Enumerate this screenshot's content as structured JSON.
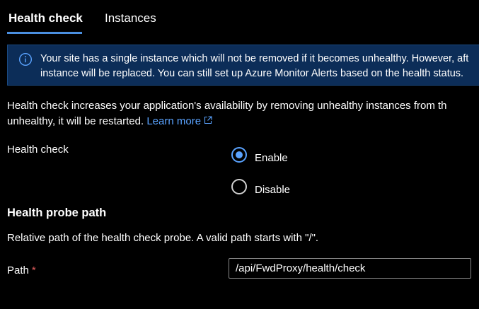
{
  "tabs": {
    "health_check": "Health check",
    "instances": "Instances"
  },
  "banner": {
    "icon": "info-icon",
    "line1": "Your site has a single instance which will not be removed if it becomes unhealthy. However, aft",
    "line2": "instance will be replaced. You can still set up Azure Monitor Alerts based on the health status."
  },
  "description": {
    "line1": "Health check increases your application's availability by removing unhealthy instances from th",
    "line2_prefix": "unhealthy, it will be restarted.",
    "learn_more": "Learn more",
    "learn_more_icon": "external-link-icon"
  },
  "health_check_field": {
    "label": "Health check",
    "options": [
      "Enable",
      "Disable"
    ],
    "selected": "Enable"
  },
  "probe_section": {
    "title": "Health probe path",
    "description": "Relative path of the health check probe. A valid path starts with \"/\"."
  },
  "path_field": {
    "label": "Path",
    "required_marker": "*",
    "value": "/api/FwdProxy/health/check"
  },
  "colors": {
    "background": "#000000",
    "accent": "#4a8fe0",
    "link": "#5aa3ff",
    "banner_background": "#0c2d58",
    "required": "#e05c5c"
  }
}
